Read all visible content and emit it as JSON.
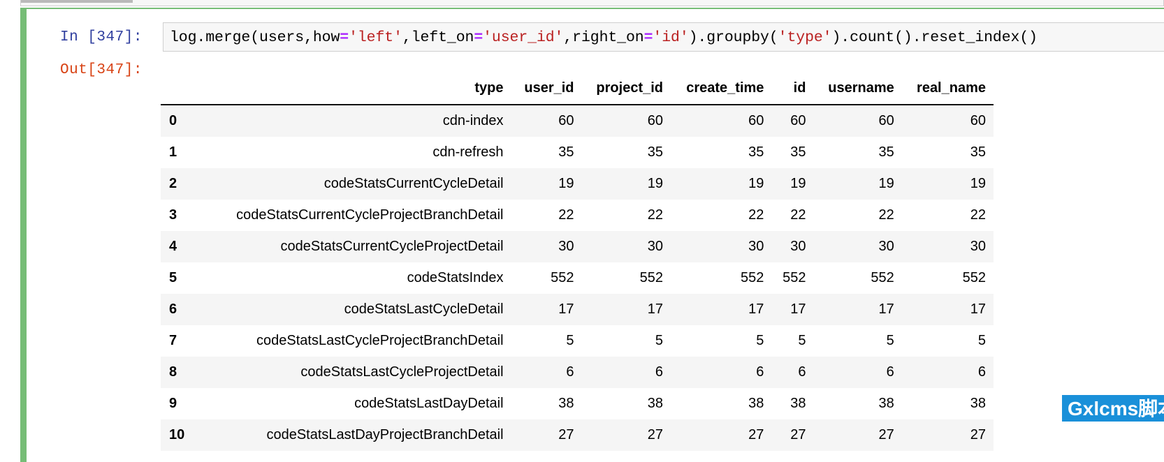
{
  "notebook": {
    "input_prompt": "In [347]:",
    "output_prompt": "Out[347]:",
    "code_tokens": [
      {
        "text": "log.merge(users,how",
        "type": "plain"
      },
      {
        "text": "=",
        "type": "op"
      },
      {
        "text": "'left'",
        "type": "str"
      },
      {
        "text": ",left_on",
        "type": "plain"
      },
      {
        "text": "=",
        "type": "op"
      },
      {
        "text": "'user_id'",
        "type": "str"
      },
      {
        "text": ",right_on",
        "type": "plain"
      },
      {
        "text": "=",
        "type": "op"
      },
      {
        "text": "'id'",
        "type": "str"
      },
      {
        "text": ").groupby(",
        "type": "plain"
      },
      {
        "text": "'type'",
        "type": "str"
      },
      {
        "text": ").count().reset_index()",
        "type": "plain"
      }
    ],
    "code_plain": "log.merge(users,how='left',left_on='user_id',right_on='id').groupby('type').count().reset_index()",
    "colors": {
      "in_prompt": "#303F9F",
      "out_prompt": "#D84315",
      "string": "#BA2121",
      "operator": "#AA22FF",
      "cell_selected_border": "#76bd76",
      "input_box_bg": "#f7f7f7",
      "row_stripe": "#f5f5f5"
    }
  },
  "dataframe": {
    "index_header": "",
    "columns": [
      "type",
      "user_id",
      "project_id",
      "create_time",
      "id",
      "username",
      "real_name"
    ],
    "rows": [
      {
        "index": "0",
        "values": [
          "cdn-index",
          "60",
          "60",
          "60",
          "60",
          "60",
          "60"
        ]
      },
      {
        "index": "1",
        "values": [
          "cdn-refresh",
          "35",
          "35",
          "35",
          "35",
          "35",
          "35"
        ]
      },
      {
        "index": "2",
        "values": [
          "codeStatsCurrentCycleDetail",
          "19",
          "19",
          "19",
          "19",
          "19",
          "19"
        ]
      },
      {
        "index": "3",
        "values": [
          "codeStatsCurrentCycleProjectBranchDetail",
          "22",
          "22",
          "22",
          "22",
          "22",
          "22"
        ]
      },
      {
        "index": "4",
        "values": [
          "codeStatsCurrentCycleProjectDetail",
          "30",
          "30",
          "30",
          "30",
          "30",
          "30"
        ]
      },
      {
        "index": "5",
        "values": [
          "codeStatsIndex",
          "552",
          "552",
          "552",
          "552",
          "552",
          "552"
        ]
      },
      {
        "index": "6",
        "values": [
          "codeStatsLastCycleDetail",
          "17",
          "17",
          "17",
          "17",
          "17",
          "17"
        ]
      },
      {
        "index": "7",
        "values": [
          "codeStatsLastCycleProjectBranchDetail",
          "5",
          "5",
          "5",
          "5",
          "5",
          "5"
        ]
      },
      {
        "index": "8",
        "values": [
          "codeStatsLastCycleProjectDetail",
          "6",
          "6",
          "6",
          "6",
          "6",
          "6"
        ]
      },
      {
        "index": "9",
        "values": [
          "codeStatsLastDayDetail",
          "38",
          "38",
          "38",
          "38",
          "38",
          "38"
        ]
      },
      {
        "index": "10",
        "values": [
          "codeStatsLastDayProjectBranchDetail",
          "27",
          "27",
          "27",
          "27",
          "27",
          "27"
        ]
      }
    ]
  },
  "watermark": {
    "text": "Gxlcms脚本",
    "background": "#1a90d9"
  }
}
